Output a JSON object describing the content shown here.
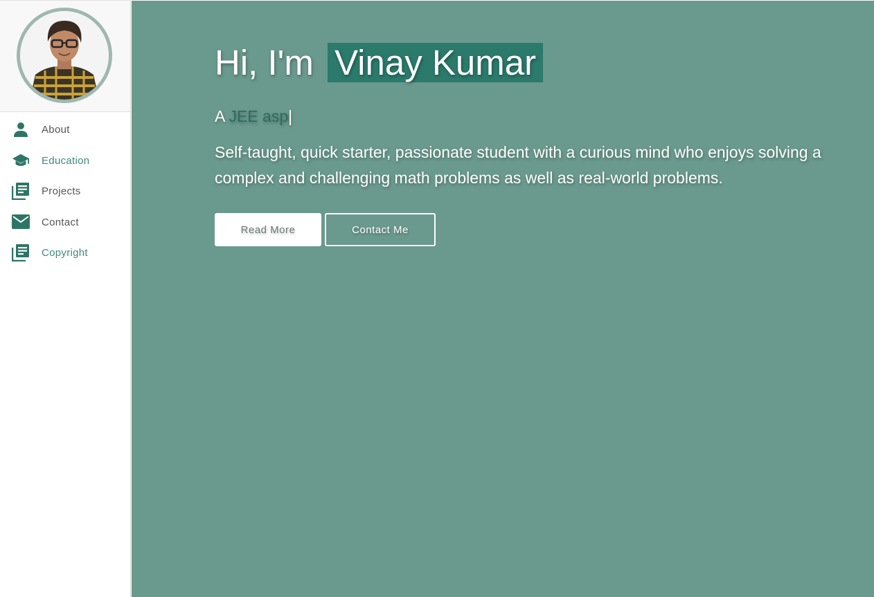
{
  "sidebar": {
    "items": [
      {
        "label": "About",
        "icon": "person-icon"
      },
      {
        "label": "Education",
        "icon": "graduation-cap-icon"
      },
      {
        "label": "Projects",
        "icon": "documents-icon"
      },
      {
        "label": "Contact",
        "icon": "envelope-icon"
      },
      {
        "label": "Copyright",
        "icon": "documents-icon"
      }
    ]
  },
  "hero": {
    "greeting": "Hi, I'm",
    "name": "Vinay Kumar",
    "tagline_prefix": "A",
    "tagline_typed": "JEE asp",
    "tagline_cursor": "|",
    "description": "Self-taught, quick starter, passionate student with a curious mind who enjoys solving a complex and challenging math problems as well as real-world problems.",
    "read_more_label": "Read More",
    "contact_label": "Contact Me"
  },
  "colors": {
    "accent": "#2b7a6c",
    "background": "#6a998d",
    "nav_icon": "#2d7567",
    "active_nav": "#3e8a7c"
  }
}
